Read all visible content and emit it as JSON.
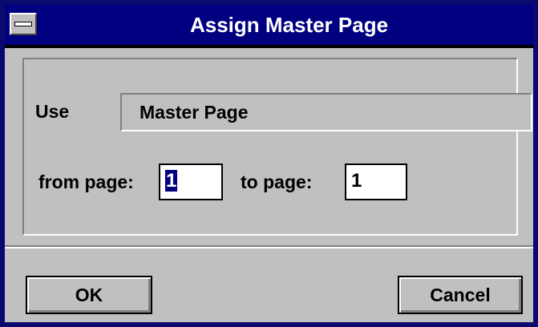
{
  "window": {
    "title": "Assign Master Page"
  },
  "use": {
    "label": "Use",
    "value": "Master Page"
  },
  "range": {
    "from_label": "from page:",
    "from_value": "1",
    "to_label": "to page:",
    "to_value": "1"
  },
  "buttons": {
    "ok": "OK",
    "cancel": "Cancel"
  }
}
